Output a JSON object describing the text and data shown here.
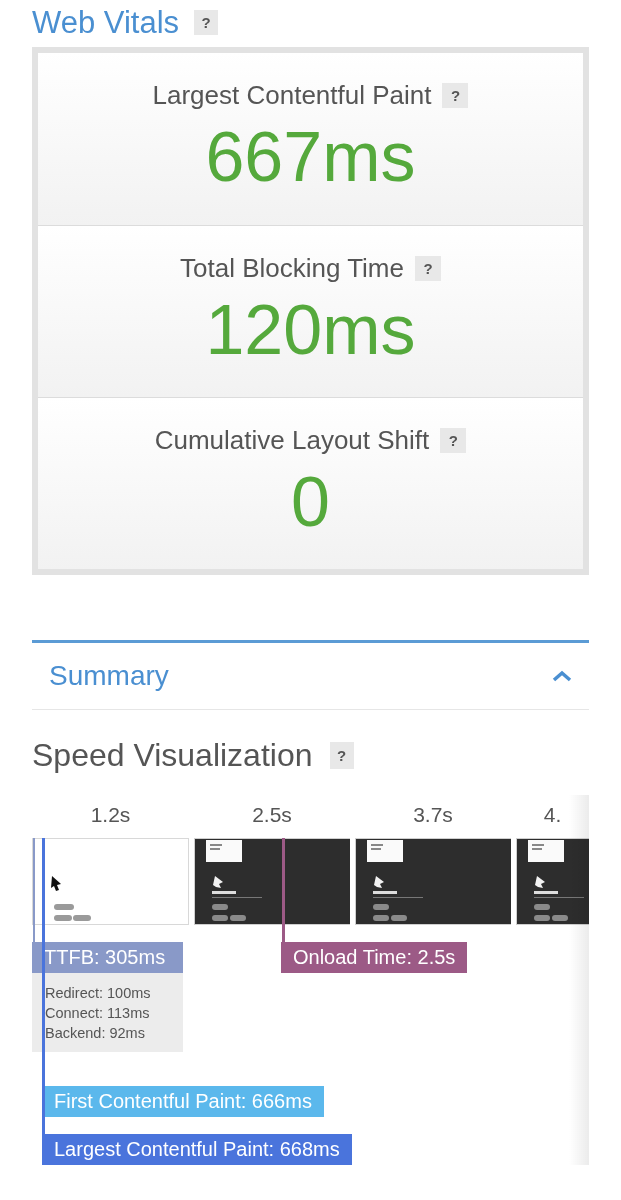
{
  "web_vitals": {
    "title": "Web Vitals",
    "help": "?",
    "metrics": [
      {
        "label": "Largest Contentful Paint",
        "help": "?",
        "value": "667ms",
        "good": true
      },
      {
        "label": "Total Blocking Time",
        "help": "?",
        "value": "120ms",
        "good": true
      },
      {
        "label": "Cumulative Layout Shift",
        "help": "?",
        "value": "0",
        "good": true
      }
    ]
  },
  "summary": {
    "title": "Summary",
    "expanded": true
  },
  "speed_visualization": {
    "title": "Speed Visualization",
    "help": "?",
    "frames": [
      {
        "time": "1.2s",
        "kind": "blank"
      },
      {
        "time": "2.5s",
        "kind": "rendered"
      },
      {
        "time": "3.7s",
        "kind": "rendered"
      },
      {
        "time": "4.",
        "kind": "rendered"
      }
    ],
    "markers": [
      {
        "label": "TTFB: 305ms",
        "color": "#8999c8",
        "details": [
          "Redirect: 100ms",
          "Connect: 113ms",
          "Backend: 92ms"
        ]
      },
      {
        "label": "Onload Time: 2.5s",
        "color": "#9c5a86"
      },
      {
        "label": "First Contentful Paint: 666ms",
        "color": "#5bb8ec"
      },
      {
        "label": "Largest Contentful Paint: 668ms",
        "color": "#4a74dc"
      }
    ]
  }
}
